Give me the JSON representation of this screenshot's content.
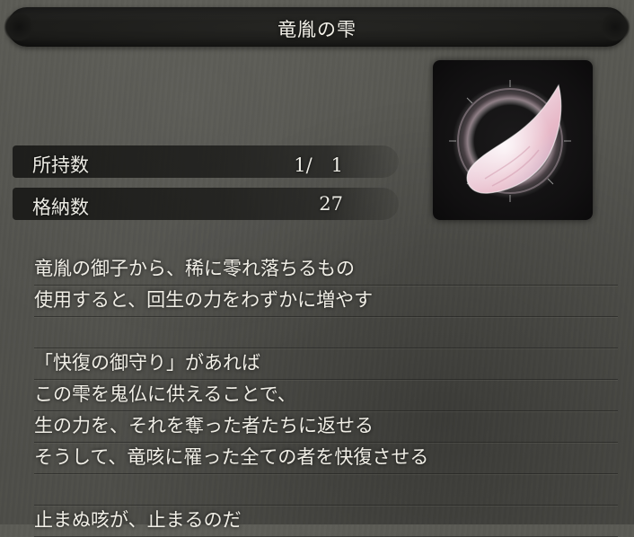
{
  "item": {
    "name": "竜胤の雫",
    "icon": "dragon-blood-droplet-icon"
  },
  "stats": {
    "held_label": "所持数",
    "held_value": "1/　1",
    "storage_label": "格納数",
    "storage_value": "27"
  },
  "description": {
    "lines": [
      "竜胤の御子から、稀に零れ落ちるもの",
      "使用すると、回生の力をわずかに増やす",
      "",
      "「快復の御守り」があれば",
      "この雫を鬼仏に供えることで、",
      "生の力を、それを奪った者たちに返せる",
      "そうして、竜咳に罹った全ての者を快復させる",
      "",
      "止まぬ咳が、止まるのだ"
    ]
  }
}
